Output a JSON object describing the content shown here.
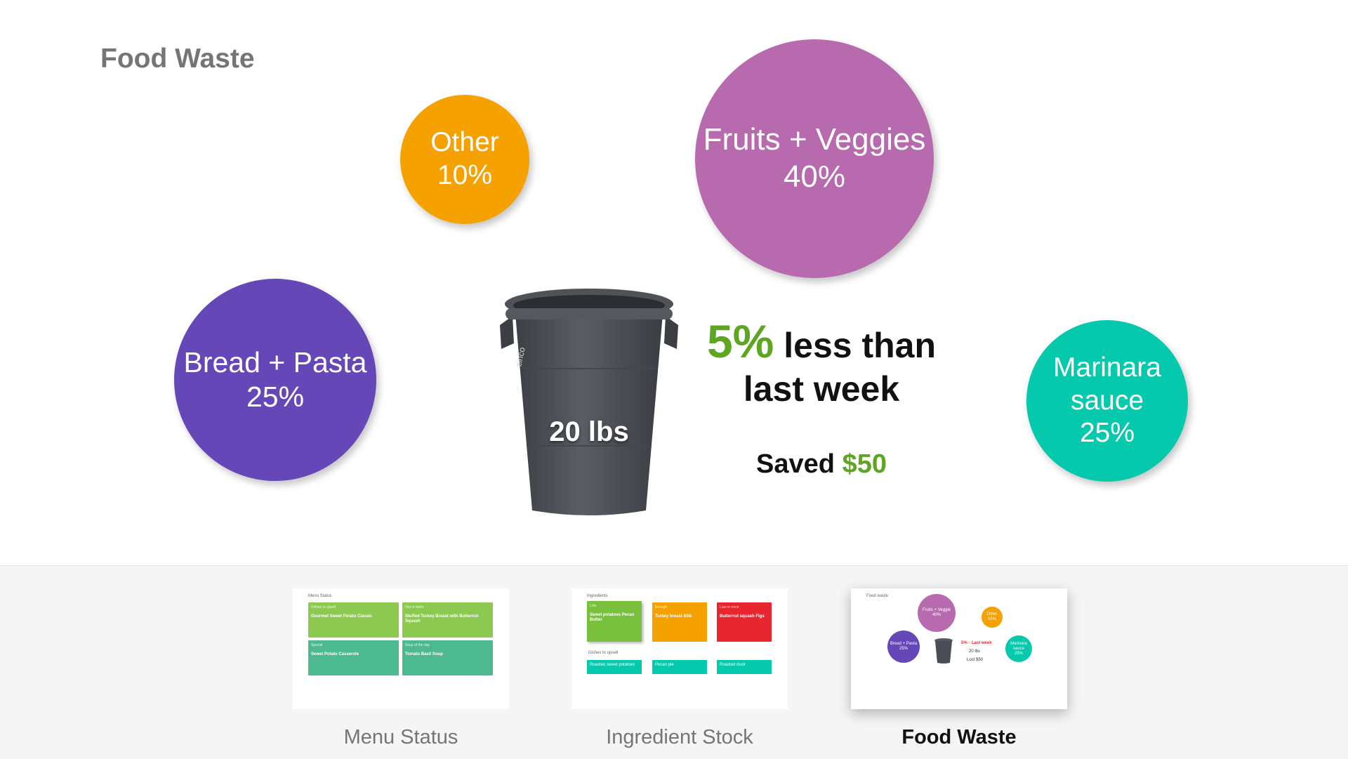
{
  "page": {
    "title": "Food Waste"
  },
  "categories": [
    {
      "id": "other",
      "name": "Other",
      "percent": "10%",
      "color": "#f5a100"
    },
    {
      "id": "fruits",
      "name": "Fruits + Veggies",
      "percent": "40%",
      "color": "#b76aad"
    },
    {
      "id": "bread",
      "name": "Bread + Pasta",
      "percent": "25%",
      "color": "#6647b8"
    },
    {
      "id": "marinara",
      "name_line1": "Marinara",
      "name_line2": "sauce",
      "percent": "25%",
      "color": "#05c9ad"
    }
  ],
  "bin": {
    "weight": "20 lbs",
    "brand": "cinco"
  },
  "comparison": {
    "percent": "5%",
    "line1_suffix": "less than",
    "line2": "last week",
    "accent_color": "#5ea522"
  },
  "savings": {
    "label": "Saved",
    "amount": "$50"
  },
  "nav": {
    "items": [
      {
        "label": "Menu Status",
        "active": false
      },
      {
        "label": "Ingredient Stock",
        "active": false
      },
      {
        "label": "Food Waste",
        "active": true
      }
    ]
  },
  "thumbs": {
    "menu": {
      "title": "Menu Status",
      "cards": [
        {
          "header": "Dishes to upsell",
          "text": "Gourmet Sweet Potato Classic",
          "color": "#8dc850"
        },
        {
          "header": "Out of stock",
          "text": "Stuffed Turkey Breast with Butternut Squash",
          "color": "#8dc850"
        },
        {
          "header": "Special",
          "text": "Sweet Potato Casserole",
          "color": "#4db990"
        },
        {
          "header": "Soup of the day",
          "text": "Tomato Basil Soup",
          "color": "#4db990"
        }
      ]
    },
    "ingredients": {
      "title": "Ingredients",
      "cards": [
        {
          "header": "Lots",
          "text": "Sweet potatoes Pecan Butter",
          "color": "#79c13d"
        },
        {
          "header": "Enough",
          "text": "Turkey breast Milk",
          "color": "#f5a100"
        },
        {
          "header": "Low or none",
          "text": "Butternut squash Figs",
          "color": "#e8262f"
        }
      ],
      "upsell_label": "Dishes to upsell",
      "upsell": [
        "Roasted sweet potatoes",
        "Pecan pie",
        "Roasted duck"
      ]
    },
    "waste": {
      "title": "Food waste",
      "fruits": "Fruits + Veggie",
      "fruits_pct": "40%",
      "other": "Other",
      "other_pct": "10%",
      "bread": "Bread + Pasta",
      "bread_pct": "25%",
      "marinara": "Marinara sauce",
      "marinara_pct": "25%",
      "stat": "5% ↑ Last week",
      "weight": "20 lbs",
      "lost": "Lost $50"
    }
  }
}
